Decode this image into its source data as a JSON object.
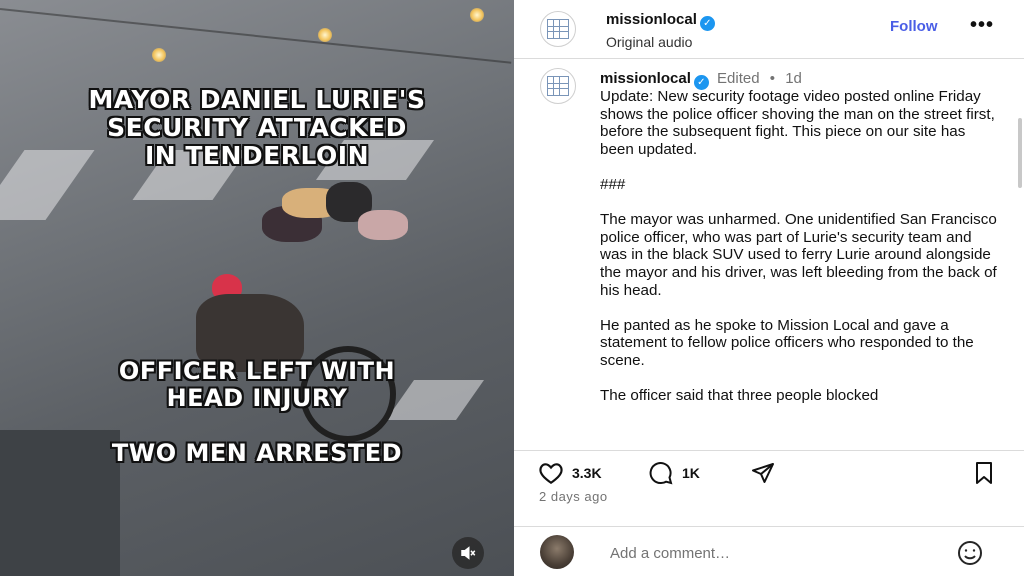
{
  "video": {
    "caption_top": "MAYOR DANIEL LURIE'S\nSECURITY ATTACKED\nIN TENDERLOIN",
    "caption_mid": "OFFICER LEFT WITH\nHEAD INJURY",
    "caption_bottom": "TWO MEN ARRESTED",
    "mute_icon": "speaker-muted-icon"
  },
  "header": {
    "username": "missionlocal",
    "subtitle": "Original audio",
    "follow_label": "Follow",
    "more_label": "•••"
  },
  "post": {
    "username": "missionlocal",
    "edited": "Edited",
    "separator": "•",
    "age": "1d",
    "paragraphs": [
      "Update: New security footage video posted online Friday shows the police officer shoving the man on the street first, before the subsequent fight. This piece on our site has been updated.",
      "###",
      "The mayor was unharmed. One unidentified San Francisco police officer, who was part of Lurie's security team and was in the black SUV used to ferry Lurie around alongside the mayor and his driver, was left bleeding from the back of his head.",
      "He panted as he spoke to Mission Local and gave a statement to fellow police officers who responded to the scene.",
      "The officer said that three people blocked"
    ]
  },
  "actions": {
    "likes": "3.3K",
    "comments": "1K",
    "posted": "2 days ago"
  },
  "comment_box": {
    "placeholder": "Add a comment…"
  },
  "colors": {
    "accent": "#4a5ee6",
    "verified": "#1c96f0",
    "muted_text": "#737373"
  }
}
